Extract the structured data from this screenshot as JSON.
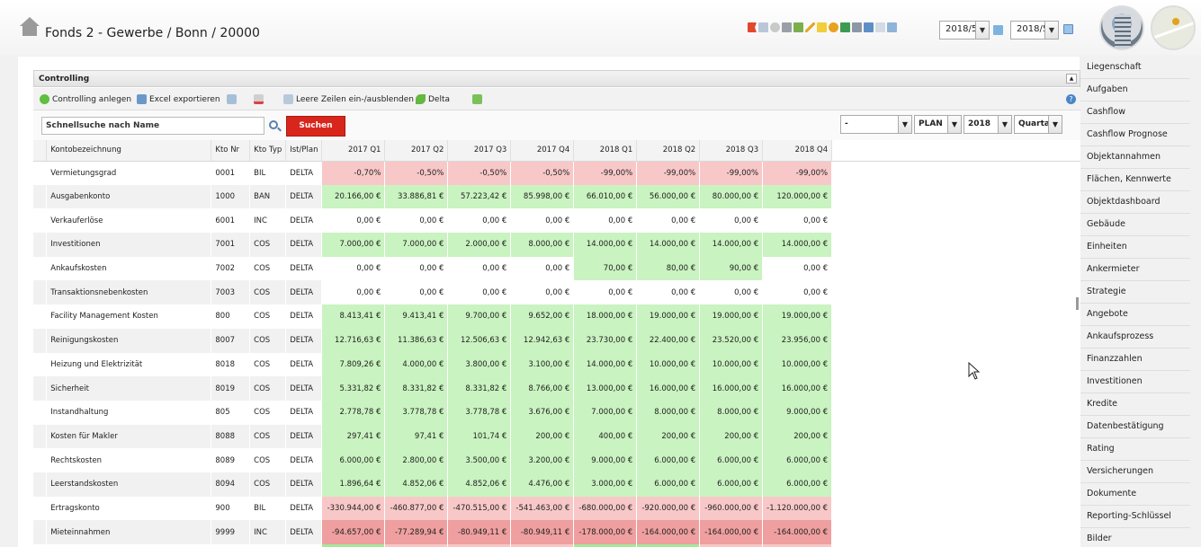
{
  "header": {
    "title": "Fonds 2 - Gewerbe / Bonn / 20000",
    "period_from": "2018/5",
    "period_to": "2018/5"
  },
  "panel": {
    "title": "Controlling"
  },
  "toolbar": {
    "anlegen": "Controlling anlegen",
    "export": "Excel exportieren",
    "leere_zeilen": "Leere Zeilen ein-/ausblenden",
    "delta": "Delta"
  },
  "search": {
    "value": "Schnellsuche nach Name",
    "button": "Suchen",
    "filter1": "-",
    "filter2": "PLAN",
    "filter3": "2018",
    "filter4": "Quartal"
  },
  "table": {
    "columns": [
      "Kontobezeichnung",
      "Kto Nr",
      "Kto Typ",
      "Ist/Plan",
      "2017 Q1",
      "2017 Q2",
      "2017 Q3",
      "2017 Q4",
      "2018 Q1",
      "2018 Q2",
      "2018 Q3",
      "2018 Q4"
    ],
    "rows": [
      {
        "name": "Vermietungsgrad",
        "nr": "0001",
        "typ": "BIL",
        "ip": "DELTA",
        "v": [
          "-0,70%",
          "-0,50%",
          "-0,50%",
          "-0,50%",
          "-99,00%",
          "-99,00%",
          "-99,00%",
          "-99,00%"
        ],
        "c": [
          "r",
          "r",
          "r",
          "r",
          "r",
          "r",
          "r",
          "r"
        ]
      },
      {
        "name": "Ausgabenkonto",
        "nr": "1000",
        "typ": "BAN",
        "ip": "DELTA",
        "v": [
          "20.166,00 €",
          "33.886,81 €",
          "57.223,42 €",
          "85.998,00 €",
          "66.010,00 €",
          "56.000,00 €",
          "80.000,00 €",
          "120.000,00 €"
        ],
        "c": [
          "g",
          "g",
          "g",
          "g",
          "g",
          "g",
          "g",
          "g"
        ]
      },
      {
        "name": "Verkauferlöse",
        "nr": "6001",
        "typ": "INC",
        "ip": "DELTA",
        "v": [
          "0,00 €",
          "0,00 €",
          "0,00 €",
          "0,00 €",
          "0,00 €",
          "0,00 €",
          "0,00 €",
          "0,00 €"
        ],
        "c": [
          "w",
          "w",
          "w",
          "w",
          "w",
          "w",
          "w",
          "w"
        ]
      },
      {
        "name": "Investitionen",
        "nr": "7001",
        "typ": "COS",
        "ip": "DELTA",
        "v": [
          "7.000,00 €",
          "7.000,00 €",
          "2.000,00 €",
          "8.000,00 €",
          "14.000,00 €",
          "14.000,00 €",
          "14.000,00 €",
          "14.000,00 €"
        ],
        "c": [
          "g",
          "g",
          "g",
          "g",
          "g",
          "g",
          "g",
          "g"
        ]
      },
      {
        "name": "Ankaufskosten",
        "nr": "7002",
        "typ": "COS",
        "ip": "DELTA",
        "v": [
          "0,00 €",
          "0,00 €",
          "0,00 €",
          "0,00 €",
          "70,00 €",
          "80,00 €",
          "90,00 €",
          "0,00 €"
        ],
        "c": [
          "w",
          "w",
          "w",
          "w",
          "g",
          "g",
          "g",
          "w"
        ]
      },
      {
        "name": "Transaktionsnebenkosten",
        "nr": "7003",
        "typ": "COS",
        "ip": "DELTA",
        "v": [
          "0,00 €",
          "0,00 €",
          "0,00 €",
          "0,00 €",
          "0,00 €",
          "0,00 €",
          "0,00 €",
          "0,00 €"
        ],
        "c": [
          "w",
          "w",
          "w",
          "w",
          "w",
          "w",
          "w",
          "w"
        ]
      },
      {
        "name": "Facility Management Kosten",
        "nr": "800",
        "typ": "COS",
        "ip": "DELTA",
        "v": [
          "8.413,41 €",
          "9.413,41 €",
          "9.700,00 €",
          "9.652,00 €",
          "18.000,00 €",
          "19.000,00 €",
          "19.000,00 €",
          "19.000,00 €"
        ],
        "c": [
          "g",
          "g",
          "g",
          "g",
          "g",
          "g",
          "g",
          "g"
        ]
      },
      {
        "name": "Reinigungskosten",
        "nr": "8007",
        "typ": "COS",
        "ip": "DELTA",
        "v": [
          "12.716,63 €",
          "11.386,63 €",
          "12.506,63 €",
          "12.942,63 €",
          "23.730,00 €",
          "22.400,00 €",
          "23.520,00 €",
          "23.956,00 €"
        ],
        "c": [
          "g",
          "g",
          "g",
          "g",
          "g",
          "g",
          "g",
          "g"
        ]
      },
      {
        "name": "Heizung und Elektrizität",
        "nr": "8018",
        "typ": "COS",
        "ip": "DELTA",
        "v": [
          "7.809,26 €",
          "4.000,00 €",
          "3.800,00 €",
          "3.100,00 €",
          "14.000,00 €",
          "10.000,00 €",
          "10.000,00 €",
          "10.000,00 €"
        ],
        "c": [
          "g",
          "g",
          "g",
          "g",
          "g",
          "g",
          "g",
          "g"
        ]
      },
      {
        "name": "Sicherheit",
        "nr": "8019",
        "typ": "COS",
        "ip": "DELTA",
        "v": [
          "5.331,82 €",
          "8.331,82 €",
          "8.331,82 €",
          "8.766,00 €",
          "13.000,00 €",
          "16.000,00 €",
          "16.000,00 €",
          "16.000,00 €"
        ],
        "c": [
          "g",
          "g",
          "g",
          "g",
          "g",
          "g",
          "g",
          "g"
        ]
      },
      {
        "name": "Instandhaltung",
        "nr": "805",
        "typ": "COS",
        "ip": "DELTA",
        "v": [
          "2.778,78 €",
          "3.778,78 €",
          "3.778,78 €",
          "3.676,00 €",
          "7.000,00 €",
          "8.000,00 €",
          "8.000,00 €",
          "9.000,00 €"
        ],
        "c": [
          "g",
          "g",
          "g",
          "g",
          "g",
          "g",
          "g",
          "g"
        ]
      },
      {
        "name": "Kosten für Makler",
        "nr": "8088",
        "typ": "COS",
        "ip": "DELTA",
        "v": [
          "297,41 €",
          "97,41 €",
          "101,74 €",
          "200,00 €",
          "400,00 €",
          "200,00 €",
          "200,00 €",
          "200,00 €"
        ],
        "c": [
          "g",
          "g",
          "g",
          "g",
          "g",
          "g",
          "g",
          "g"
        ]
      },
      {
        "name": "Rechtskosten",
        "nr": "8089",
        "typ": "COS",
        "ip": "DELTA",
        "v": [
          "6.000,00 €",
          "2.800,00 €",
          "3.500,00 €",
          "3.200,00 €",
          "9.000,00 €",
          "6.000,00 €",
          "6.000,00 €",
          "6.000,00 €"
        ],
        "c": [
          "g",
          "g",
          "g",
          "g",
          "g",
          "g",
          "g",
          "g"
        ]
      },
      {
        "name": "Leerstandskosten",
        "nr": "8094",
        "typ": "COS",
        "ip": "DELTA",
        "v": [
          "1.896,64 €",
          "4.852,06 €",
          "4.852,06 €",
          "4.476,00 €",
          "3.000,00 €",
          "6.000,00 €",
          "6.000,00 €",
          "6.000,00 €"
        ],
        "c": [
          "g",
          "g",
          "g",
          "g",
          "g",
          "g",
          "g",
          "g"
        ]
      },
      {
        "name": "Ertragskonto",
        "nr": "900",
        "typ": "BIL",
        "ip": "DELTA",
        "v": [
          "-330.944,00 €",
          "-460.877,00 €",
          "-470.515,00 €",
          "-541.463,00 €",
          "-680.000,00 €",
          "-920.000,00 €",
          "-960.000,00 €",
          "-1.120.000,00 €"
        ],
        "c": [
          "r",
          "r",
          "r",
          "r",
          "r",
          "r",
          "r",
          "r"
        ]
      },
      {
        "name": "Mieteinnahmen",
        "nr": "9999",
        "typ": "INC",
        "ip": "DELTA",
        "v": [
          "-94.657,00 €",
          "-77.289,94 €",
          "-80.949,11 €",
          "-80.949,11 €",
          "-178.000,00 €",
          "-164.000,00 €",
          "-164.000,00 €",
          "-164.000,00 €"
        ],
        "c": [
          "R",
          "R",
          "R",
          "R",
          "R",
          "R",
          "R",
          "R"
        ]
      },
      {
        "name": "",
        "nr": "",
        "typ": "",
        "ip": "",
        "v": [
          "",
          "",
          "",
          "",
          "",
          "",
          "",
          ""
        ],
        "c": [
          "G",
          "r",
          "r",
          "r",
          "G",
          "G",
          "r",
          "r"
        ]
      }
    ]
  },
  "sidebar": {
    "items": [
      "Liegenschaft",
      "Aufgaben",
      "Cashflow",
      "Cashflow Prognose",
      "Objektannahmen",
      "Flächen, Kennwerte",
      "Objektdashboard",
      "Gebäude",
      "Einheiten",
      "Ankermieter",
      "Strategie",
      "Angebote",
      "Ankaufsprozess",
      "Finanzzahlen",
      "Investitionen",
      "Kredite",
      "Datenbestätigung",
      "Rating",
      "Versicherungen",
      "Dokumente",
      "Reporting-Schlüssel",
      "Bilder"
    ]
  },
  "colors": {
    "green": "#c9f3c0",
    "red": "#f8c8c8",
    "dark_red": "#ef9f9f",
    "button_red": "#d9261c"
  }
}
